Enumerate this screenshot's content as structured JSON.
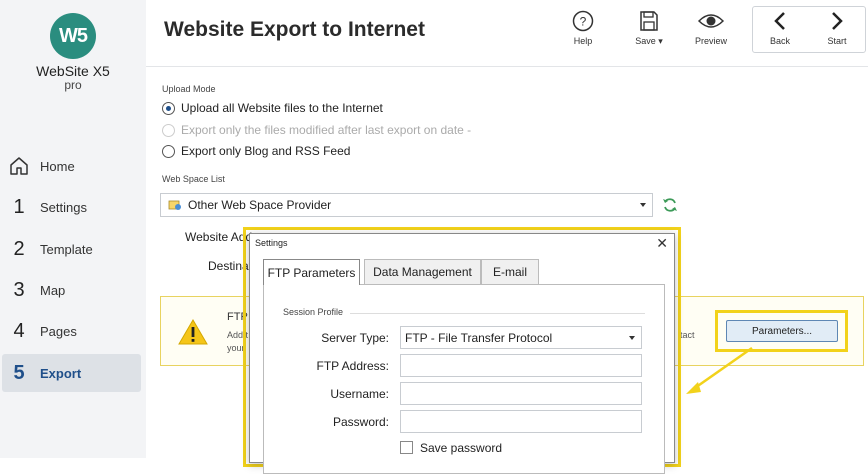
{
  "app": {
    "logo_mark": "W5",
    "logo_name": "WebSite X5",
    "logo_edition": "pro"
  },
  "sidebar": {
    "items": [
      {
        "num": "",
        "label": "Home",
        "icon": "home-icon"
      },
      {
        "num": "1",
        "label": "Settings"
      },
      {
        "num": "2",
        "label": "Template"
      },
      {
        "num": "3",
        "label": "Map"
      },
      {
        "num": "4",
        "label": "Pages"
      },
      {
        "num": "5",
        "label": "Export"
      }
    ]
  },
  "header": {
    "title": "Website Export to Internet",
    "help_label": "Help",
    "save_label": "Save",
    "preview_label": "Preview",
    "back_label": "Back",
    "start_label": "Start"
  },
  "upload_mode": {
    "label": "Upload Mode",
    "options": [
      {
        "label": "Upload all Website files to the Internet",
        "selected": true,
        "enabled": true
      },
      {
        "label": "Export only the files modified after last export on date -",
        "selected": false,
        "enabled": false
      },
      {
        "label": "Export only Blog and RSS Feed",
        "selected": false,
        "enabled": true
      }
    ]
  },
  "web_space": {
    "label": "Web Space List",
    "selected": "Other Web Space Provider",
    "website_address_label": "Website Addr",
    "destination_label": "Destinat"
  },
  "ftp_panel": {
    "title": "FTP",
    "desc_line1": "Add t",
    "desc_line2": "your",
    "desc_tail": "tact",
    "parameters_button": "Parameters..."
  },
  "dialog": {
    "title": "Settings",
    "close_glyph": "✕",
    "tabs": [
      "FTP Parameters",
      "Data Management",
      "E-mail"
    ],
    "group_label": "Session Profile",
    "server_type_label": "Server Type:",
    "server_type_value": "FTP - File Transfer Protocol",
    "ftp_address_label": "FTP Address:",
    "username_label": "Username:",
    "password_label": "Password:",
    "save_password_label": "Save password"
  },
  "colors": {
    "accent": "#1f4f8a",
    "logo": "#2a8d7f",
    "highlight": "#f2d21b",
    "refresh": "#3c9a58"
  }
}
